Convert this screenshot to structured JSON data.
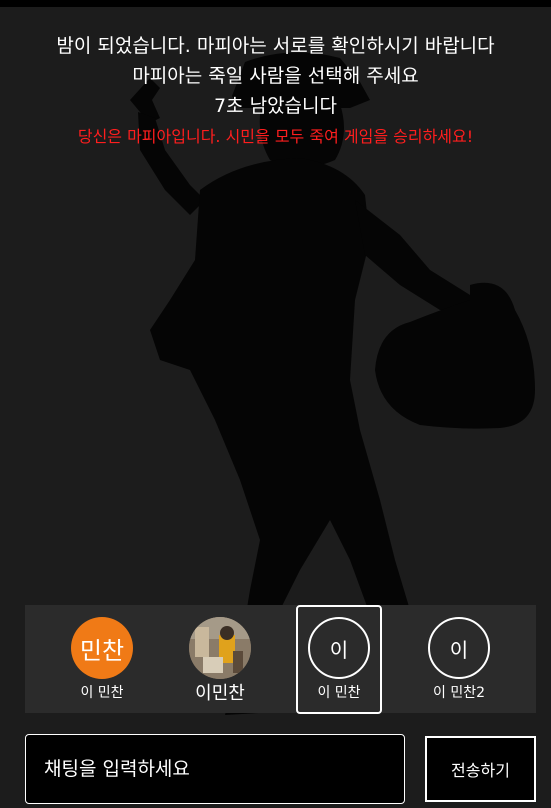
{
  "announcement": {
    "line1": "밤이 되었습니다. 마피아는 서로를 확인하시기 바랍니다",
    "line2": "마피아는 죽일 사람을 선택해 주세요",
    "countdown": "7초 남았습니다",
    "role_notice": "당신은 마피아입니다. 시민을 모두 죽여 게임을 승리하세요!"
  },
  "players": [
    {
      "name": "이 민찬",
      "avatar_text": "민찬",
      "avatar_style": "orange",
      "selected": false
    },
    {
      "name": "이민찬",
      "avatar_text": "",
      "avatar_style": "photo",
      "selected": false
    },
    {
      "name": "이 민찬",
      "avatar_text": "이",
      "avatar_style": "ring",
      "selected": true
    },
    {
      "name": "이 민찬2",
      "avatar_text": "이",
      "avatar_style": "ring",
      "selected": false
    }
  ],
  "chat": {
    "placeholder": "채팅을 입력하세요",
    "send_label": "전송하기"
  },
  "colors": {
    "background": "#1c1c1c",
    "notice_red": "#ff1e1e",
    "avatar_orange": "#f07a16",
    "player_bar": "#2b2b2b"
  },
  "icons": {
    "background": "mafia-silhouette-icon"
  }
}
